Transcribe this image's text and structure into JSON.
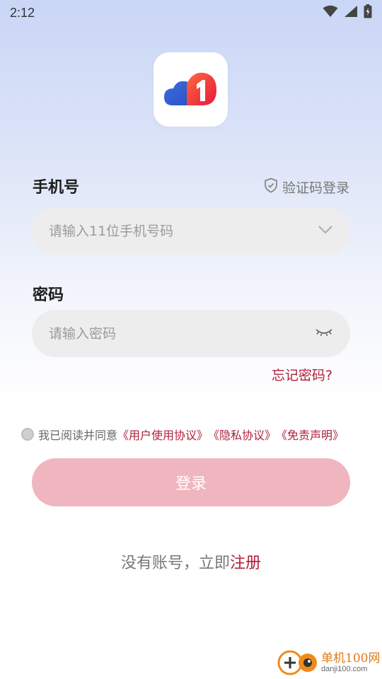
{
  "status_bar": {
    "time": "2:12"
  },
  "login": {
    "phone_label": "手机号",
    "sms_login_label": "验证码登录",
    "phone_placeholder": "请输入11位手机号码",
    "password_label": "密码",
    "password_placeholder": "请输入密码",
    "forgot_label": "忘记密码?",
    "agree_prefix": "我已阅读并同意",
    "agree_user": "《用户使用协议》",
    "agree_privacy": "《隐私协议》",
    "agree_disclaimer": "《免责声明》",
    "login_button": "登录",
    "register_prefix": "没有账号，立即",
    "register_link": "注册"
  },
  "watermark": {
    "title": "单机100网",
    "url": "danji100.com"
  },
  "colors": {
    "accent": "#b0203a",
    "button_disabled": "#f0b6c0",
    "field_bg": "#ededed"
  },
  "icons": {
    "app": "cloud-one-logo",
    "wifi": "wifi-icon",
    "signal": "signal-icon",
    "battery": "battery-charging-icon",
    "shield": "shield-check-icon",
    "chevron": "chevron-down-icon",
    "eye": "eye-closed-icon"
  }
}
